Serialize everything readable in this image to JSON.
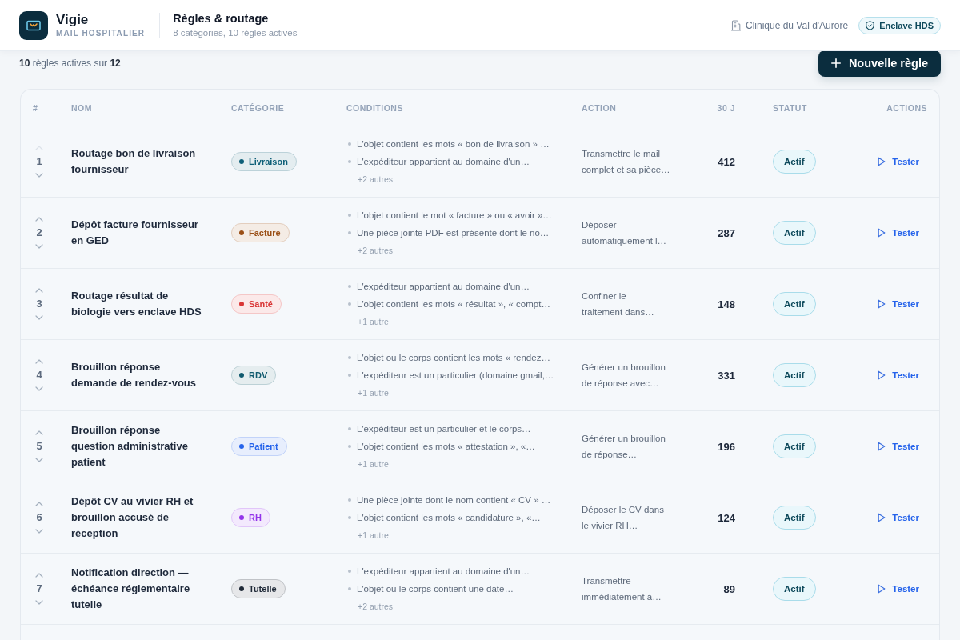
{
  "app": {
    "name": "Vigie",
    "tagline": "MAIL HOSPITALIER"
  },
  "page": {
    "title": "Règles & routage",
    "subtitle": "8 catégories, 10 règles actives"
  },
  "organization": {
    "name": "Clinique du Val d'Aurore"
  },
  "environment_badge": {
    "label": "Enclave HDS"
  },
  "toolbar": {
    "summary": "**10** règles actives sur **12**",
    "new_button": "Nouvelle règle"
  },
  "table": {
    "columns": [
      "#",
      "NOM",
      "CATÉGORIE",
      "CONDITIONS",
      "ACTION",
      "30 J",
      "STATUT",
      "ACTIONS"
    ],
    "rows": [
      {
        "order": "1",
        "up_disabled": true,
        "name": "Routage bon de livraison fournisseur",
        "category": {
          "label": "Livraison",
          "color": "#0e5f78"
        },
        "conditions": [
          "L'objet contient les mots « bon de livraison » …",
          "L'expéditeur appartient au domaine d'un…"
        ],
        "more": "+2 autres",
        "action": [
          "Transmettre le mail",
          "complet et sa pièce…"
        ],
        "count": "412",
        "status": "Actif",
        "test_button": "Tester"
      },
      {
        "order": "2",
        "up_disabled": false,
        "name": "Dépôt facture fournisseur en GED",
        "category": {
          "label": "Facture",
          "color": "#9a4f16"
        },
        "conditions": [
          "L'objet contient le mot « facture » ou « avoir »…",
          "Une pièce jointe PDF est présente dont le no…"
        ],
        "more": "+2 autres",
        "action": [
          "Déposer",
          "automatiquement l…"
        ],
        "count": "287",
        "status": "Actif",
        "test_button": "Tester"
      },
      {
        "order": "3",
        "up_disabled": false,
        "name": "Routage résultat de biologie vers enclave HDS",
        "category": {
          "label": "Santé",
          "color": "#d93636"
        },
        "conditions": [
          "L'expéditeur appartient au domaine d'un…",
          "L'objet contient les mots « résultat », « compt…"
        ],
        "more": "+1 autre",
        "action": [
          "Confiner le",
          "traitement dans…"
        ],
        "count": "148",
        "status": "Actif",
        "test_button": "Tester"
      },
      {
        "order": "4",
        "up_disabled": false,
        "name": "Brouillon réponse demande de rendez-vous",
        "category": {
          "label": "RDV",
          "color": "#105a6e"
        },
        "conditions": [
          "L'objet ou le corps contient les mots « rendez…",
          "L'expéditeur est un particulier (domaine gmail,…"
        ],
        "more": "+1 autre",
        "action": [
          "Générer un brouillon",
          "de réponse avec…"
        ],
        "count": "331",
        "status": "Actif",
        "test_button": "Tester"
      },
      {
        "order": "5",
        "up_disabled": false,
        "name": "Brouillon réponse question administrative patient",
        "category": {
          "label": "Patient",
          "color": "#2563eb"
        },
        "conditions": [
          "L'expéditeur est un particulier et le corps…",
          "L'objet contient les mots « attestation », «…"
        ],
        "more": "+1 autre",
        "action": [
          "Générer un brouillon",
          "de réponse…"
        ],
        "count": "196",
        "status": "Actif",
        "test_button": "Tester"
      },
      {
        "order": "6",
        "up_disabled": false,
        "name": "Dépôt CV au vivier RH et brouillon accusé de réception",
        "category": {
          "label": "RH",
          "color": "#9333ea"
        },
        "conditions": [
          "Une pièce jointe dont le nom contient « CV » …",
          "L'objet contient les mots « candidature », «…"
        ],
        "more": "+1 autre",
        "action": [
          "Déposer le CV dans",
          "le vivier RH…"
        ],
        "count": "124",
        "status": "Actif",
        "test_button": "Tester"
      },
      {
        "order": "7",
        "up_disabled": false,
        "name": "Notification direction — échéance réglementaire tutelle",
        "category": {
          "label": "Tutelle",
          "color": "#1f2937"
        },
        "conditions": [
          "L'expéditeur appartient au domaine d'un…",
          "L'objet ou le corps contient une date…"
        ],
        "more": "+2 autres",
        "action": [
          "Transmettre",
          "immédiatement à…"
        ],
        "count": "89",
        "status": "Actif",
        "test_button": "Tester"
      }
    ]
  }
}
